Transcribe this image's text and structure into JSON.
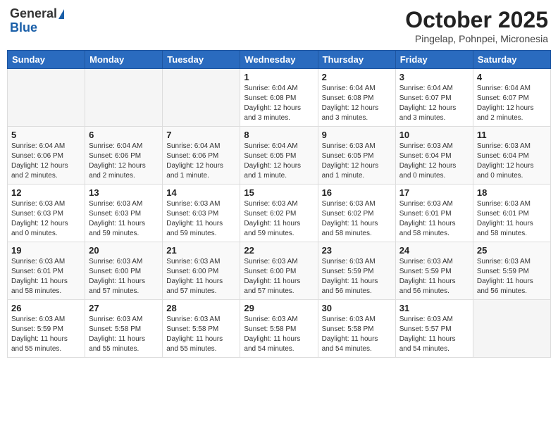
{
  "header": {
    "logo_general": "General",
    "logo_blue": "Blue",
    "month_title": "October 2025",
    "location": "Pingelap, Pohnpei, Micronesia"
  },
  "weekdays": [
    "Sunday",
    "Monday",
    "Tuesday",
    "Wednesday",
    "Thursday",
    "Friday",
    "Saturday"
  ],
  "weeks": [
    [
      {
        "day": "",
        "info": ""
      },
      {
        "day": "",
        "info": ""
      },
      {
        "day": "",
        "info": ""
      },
      {
        "day": "1",
        "info": "Sunrise: 6:04 AM\nSunset: 6:08 PM\nDaylight: 12 hours\nand 3 minutes."
      },
      {
        "day": "2",
        "info": "Sunrise: 6:04 AM\nSunset: 6:08 PM\nDaylight: 12 hours\nand 3 minutes."
      },
      {
        "day": "3",
        "info": "Sunrise: 6:04 AM\nSunset: 6:07 PM\nDaylight: 12 hours\nand 3 minutes."
      },
      {
        "day": "4",
        "info": "Sunrise: 6:04 AM\nSunset: 6:07 PM\nDaylight: 12 hours\nand 2 minutes."
      }
    ],
    [
      {
        "day": "5",
        "info": "Sunrise: 6:04 AM\nSunset: 6:06 PM\nDaylight: 12 hours\nand 2 minutes."
      },
      {
        "day": "6",
        "info": "Sunrise: 6:04 AM\nSunset: 6:06 PM\nDaylight: 12 hours\nand 2 minutes."
      },
      {
        "day": "7",
        "info": "Sunrise: 6:04 AM\nSunset: 6:06 PM\nDaylight: 12 hours\nand 1 minute."
      },
      {
        "day": "8",
        "info": "Sunrise: 6:04 AM\nSunset: 6:05 PM\nDaylight: 12 hours\nand 1 minute."
      },
      {
        "day": "9",
        "info": "Sunrise: 6:03 AM\nSunset: 6:05 PM\nDaylight: 12 hours\nand 1 minute."
      },
      {
        "day": "10",
        "info": "Sunrise: 6:03 AM\nSunset: 6:04 PM\nDaylight: 12 hours\nand 0 minutes."
      },
      {
        "day": "11",
        "info": "Sunrise: 6:03 AM\nSunset: 6:04 PM\nDaylight: 12 hours\nand 0 minutes."
      }
    ],
    [
      {
        "day": "12",
        "info": "Sunrise: 6:03 AM\nSunset: 6:03 PM\nDaylight: 12 hours\nand 0 minutes."
      },
      {
        "day": "13",
        "info": "Sunrise: 6:03 AM\nSunset: 6:03 PM\nDaylight: 11 hours\nand 59 minutes."
      },
      {
        "day": "14",
        "info": "Sunrise: 6:03 AM\nSunset: 6:03 PM\nDaylight: 11 hours\nand 59 minutes."
      },
      {
        "day": "15",
        "info": "Sunrise: 6:03 AM\nSunset: 6:02 PM\nDaylight: 11 hours\nand 59 minutes."
      },
      {
        "day": "16",
        "info": "Sunrise: 6:03 AM\nSunset: 6:02 PM\nDaylight: 11 hours\nand 58 minutes."
      },
      {
        "day": "17",
        "info": "Sunrise: 6:03 AM\nSunset: 6:01 PM\nDaylight: 11 hours\nand 58 minutes."
      },
      {
        "day": "18",
        "info": "Sunrise: 6:03 AM\nSunset: 6:01 PM\nDaylight: 11 hours\nand 58 minutes."
      }
    ],
    [
      {
        "day": "19",
        "info": "Sunrise: 6:03 AM\nSunset: 6:01 PM\nDaylight: 11 hours\nand 58 minutes."
      },
      {
        "day": "20",
        "info": "Sunrise: 6:03 AM\nSunset: 6:00 PM\nDaylight: 11 hours\nand 57 minutes."
      },
      {
        "day": "21",
        "info": "Sunrise: 6:03 AM\nSunset: 6:00 PM\nDaylight: 11 hours\nand 57 minutes."
      },
      {
        "day": "22",
        "info": "Sunrise: 6:03 AM\nSunset: 6:00 PM\nDaylight: 11 hours\nand 57 minutes."
      },
      {
        "day": "23",
        "info": "Sunrise: 6:03 AM\nSunset: 5:59 PM\nDaylight: 11 hours\nand 56 minutes."
      },
      {
        "day": "24",
        "info": "Sunrise: 6:03 AM\nSunset: 5:59 PM\nDaylight: 11 hours\nand 56 minutes."
      },
      {
        "day": "25",
        "info": "Sunrise: 6:03 AM\nSunset: 5:59 PM\nDaylight: 11 hours\nand 56 minutes."
      }
    ],
    [
      {
        "day": "26",
        "info": "Sunrise: 6:03 AM\nSunset: 5:59 PM\nDaylight: 11 hours\nand 55 minutes."
      },
      {
        "day": "27",
        "info": "Sunrise: 6:03 AM\nSunset: 5:58 PM\nDaylight: 11 hours\nand 55 minutes."
      },
      {
        "day": "28",
        "info": "Sunrise: 6:03 AM\nSunset: 5:58 PM\nDaylight: 11 hours\nand 55 minutes."
      },
      {
        "day": "29",
        "info": "Sunrise: 6:03 AM\nSunset: 5:58 PM\nDaylight: 11 hours\nand 54 minutes."
      },
      {
        "day": "30",
        "info": "Sunrise: 6:03 AM\nSunset: 5:58 PM\nDaylight: 11 hours\nand 54 minutes."
      },
      {
        "day": "31",
        "info": "Sunrise: 6:03 AM\nSunset: 5:57 PM\nDaylight: 11 hours\nand 54 minutes."
      },
      {
        "day": "",
        "info": ""
      }
    ]
  ]
}
